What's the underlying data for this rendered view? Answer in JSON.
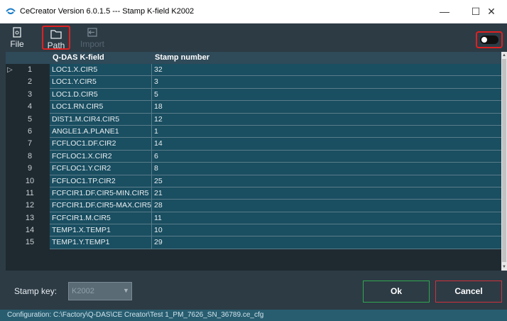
{
  "window": {
    "title": "CeCreator Version 6.0.1.5 --- Stamp K-field K2002",
    "minimize_glyph": "—",
    "maximize_glyph": "☐",
    "close_glyph": "✕"
  },
  "toolbar": {
    "file_label": "File",
    "path_label": "Path",
    "import_label": "Import",
    "file_icon": "file-icon",
    "path_icon": "folder-icon",
    "import_icon": "import-icon",
    "toggle_on": false
  },
  "grid": {
    "columns": [
      "Q-DAS K-field",
      "Stamp number"
    ],
    "selected_marker": "▷",
    "rows": [
      {
        "n": "1",
        "k": "LOC1.X.CIR5",
        "s": "32"
      },
      {
        "n": "2",
        "k": "LOC1.Y.CIR5",
        "s": "3"
      },
      {
        "n": "3",
        "k": "LOC1.D.CIR5",
        "s": "5"
      },
      {
        "n": "4",
        "k": "LOC1.RN.CIR5",
        "s": "18"
      },
      {
        "n": "5",
        "k": "DIST1.M.CIR4.CIR5",
        "s": "12"
      },
      {
        "n": "6",
        "k": "ANGLE1.A.PLANE1",
        "s": "1"
      },
      {
        "n": "7",
        "k": "FCFLOC1.DF.CIR2",
        "s": "14"
      },
      {
        "n": "8",
        "k": "FCFLOC1.X.CIR2",
        "s": "6"
      },
      {
        "n": "9",
        "k": "FCFLOC1.Y.CIR2",
        "s": "8"
      },
      {
        "n": "10",
        "k": "FCFLOC1.TP.CIR2",
        "s": "25"
      },
      {
        "n": "11",
        "k": "FCFCIR1.DF.CIR5-MIN.CIR5",
        "s": "21"
      },
      {
        "n": "12",
        "k": "FCFCIR1.DF.CIR5-MAX.CIR5",
        "s": "28"
      },
      {
        "n": "13",
        "k": "FCFCIR1.M.CIR5",
        "s": "11"
      },
      {
        "n": "14",
        "k": "TEMP1.X.TEMP1",
        "s": "10"
      },
      {
        "n": "15",
        "k": "TEMP1.Y.TEMP1",
        "s": "29"
      }
    ]
  },
  "footer": {
    "stamp_key_label": "Stamp key:",
    "stamp_key_value": "K2002",
    "ok_label": "Ok",
    "cancel_label": "Cancel"
  },
  "status": {
    "text": "Configuration:  C:\\Factory\\Q-DAS\\CE Creator\\Test 1_PM_7626_SN_36789.ce_cfg"
  },
  "colors": {
    "background": "#2d3b45",
    "cell": "#1a4e61",
    "ok_border": "#2fa84f",
    "cancel_border": "#d1313a",
    "highlight": "#e02020"
  }
}
